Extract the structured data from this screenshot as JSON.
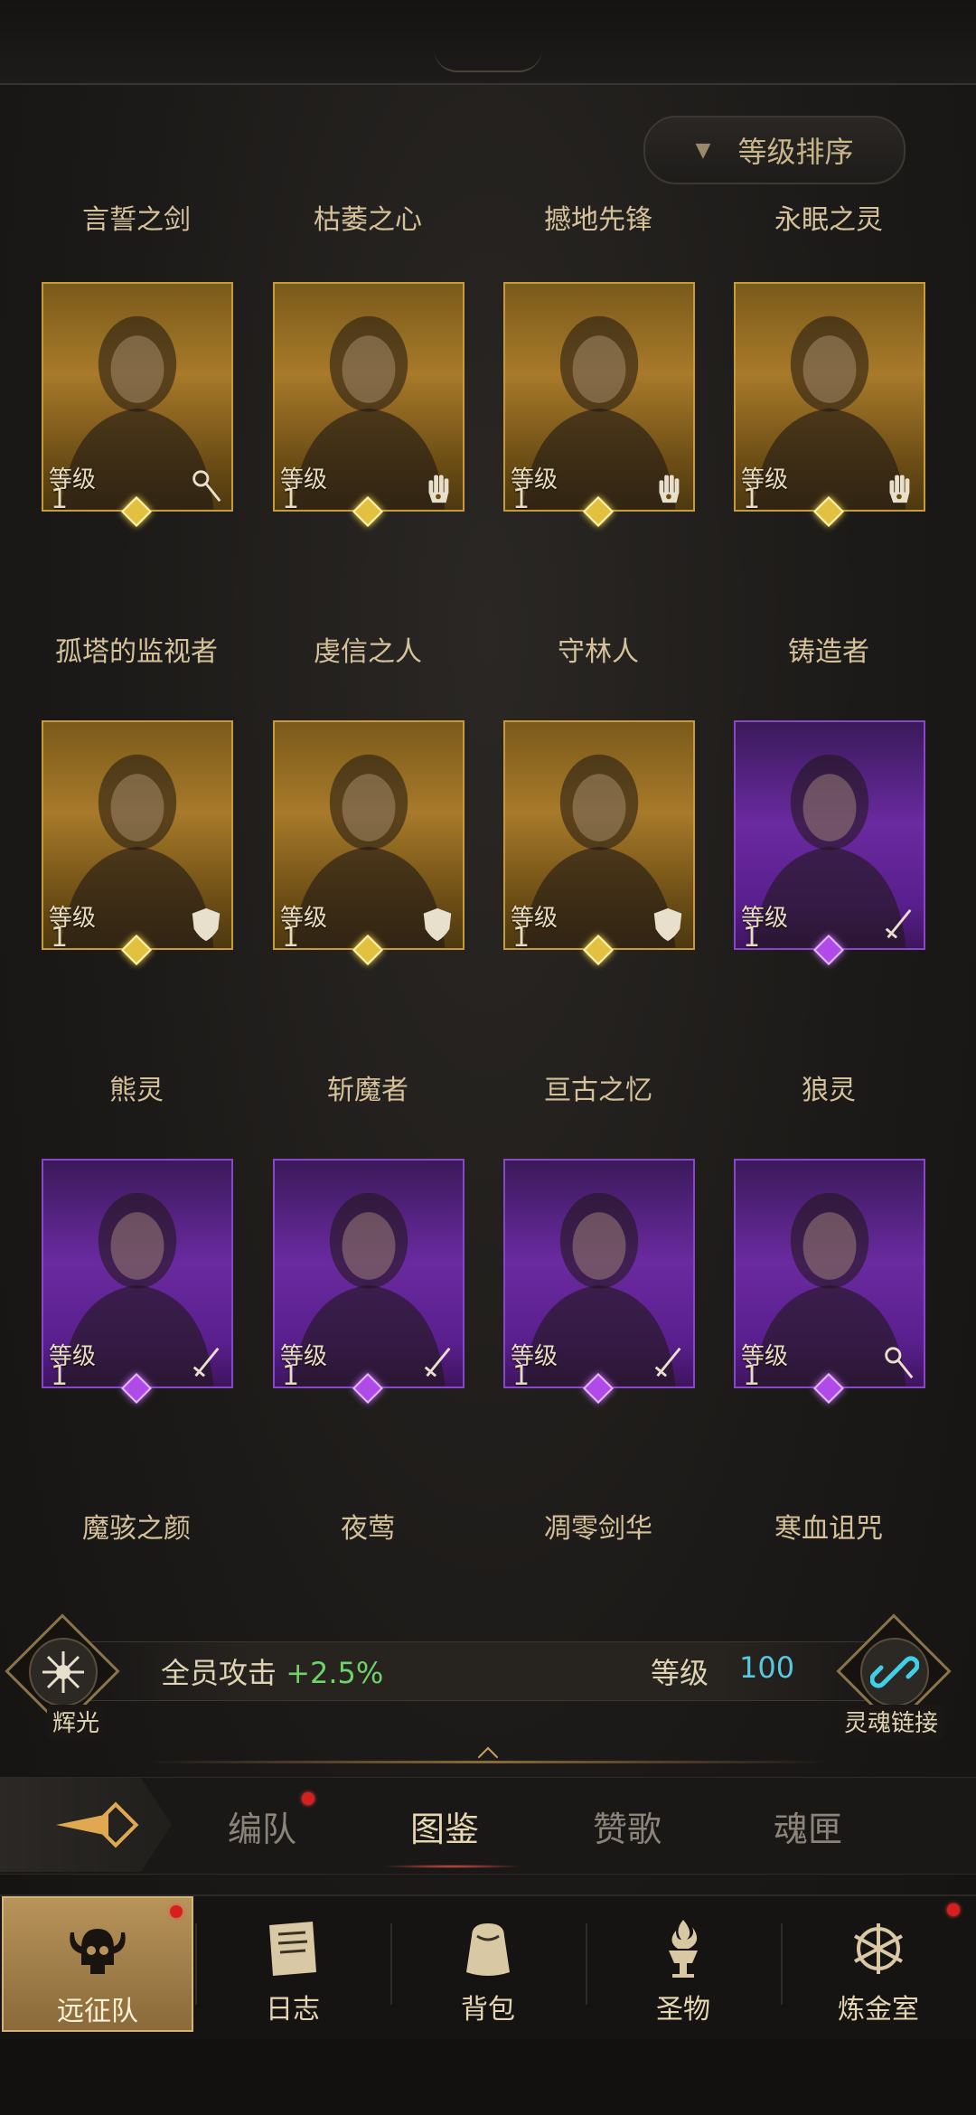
{
  "sort_button": {
    "label": "等级排序"
  },
  "level_label": "等级",
  "heroes": [
    {
      "title": "言誓之剑",
      "level": "1",
      "rarity": "gold",
      "class_icon": "staff-icon",
      "name": "孤塔的监视者"
    },
    {
      "title": "枯萎之心",
      "level": "1",
      "rarity": "gold",
      "class_icon": "hand-icon",
      "name": "虔信之人"
    },
    {
      "title": "撼地先锋",
      "level": "1",
      "rarity": "gold",
      "class_icon": "hand-icon",
      "name": "守林人"
    },
    {
      "title": "永眠之灵",
      "level": "1",
      "rarity": "gold",
      "class_icon": "hand-icon",
      "name": "铸造者"
    },
    {
      "title": "",
      "level": "1",
      "rarity": "gold",
      "class_icon": "shield-icon",
      "name": "熊灵"
    },
    {
      "title": "",
      "level": "1",
      "rarity": "gold",
      "class_icon": "shield-icon",
      "name": "斩魔者"
    },
    {
      "title": "",
      "level": "1",
      "rarity": "gold",
      "class_icon": "shield-icon",
      "name": "亘古之忆"
    },
    {
      "title": "",
      "level": "1",
      "rarity": "epic",
      "class_icon": "sword-icon",
      "name": "狼灵"
    },
    {
      "title": "",
      "level": "1",
      "rarity": "epic",
      "class_icon": "sword-icon",
      "name": "魔骇之颜"
    },
    {
      "title": "",
      "level": "1",
      "rarity": "epic",
      "class_icon": "sword-icon",
      "name": "夜莺"
    },
    {
      "title": "",
      "level": "1",
      "rarity": "epic",
      "class_icon": "sword-icon",
      "name": "凋零剑华"
    },
    {
      "title": "",
      "level": "1",
      "rarity": "epic",
      "class_icon": "staff-icon",
      "name": "寒血诅咒"
    }
  ],
  "bonus": {
    "emblem_label": "辉光",
    "text": "全员攻击",
    "value": "+2.5%",
    "level_label": "等级",
    "level_value": "100",
    "link_label": "灵魂链接"
  },
  "tabs": [
    {
      "label": "编队",
      "badge": true
    },
    {
      "label": "图鉴",
      "active": true
    },
    {
      "label": "赞歌"
    },
    {
      "label": "魂匣"
    }
  ],
  "bottom_nav": [
    {
      "label": "远征队",
      "icon": "horned-skull-icon",
      "active": true,
      "badge": true
    },
    {
      "label": "日志",
      "icon": "scroll-icon"
    },
    {
      "label": "背包",
      "icon": "bag-icon"
    },
    {
      "label": "圣物",
      "icon": "brazier-icon"
    },
    {
      "label": "炼金室",
      "icon": "alchemy-icon",
      "badge": true
    }
  ],
  "colors": {
    "gold_frame": "#c79a3a",
    "epic_frame": "#8a46c8",
    "bonus_value": "#6fd36a",
    "level_value": "#56c8e0"
  }
}
